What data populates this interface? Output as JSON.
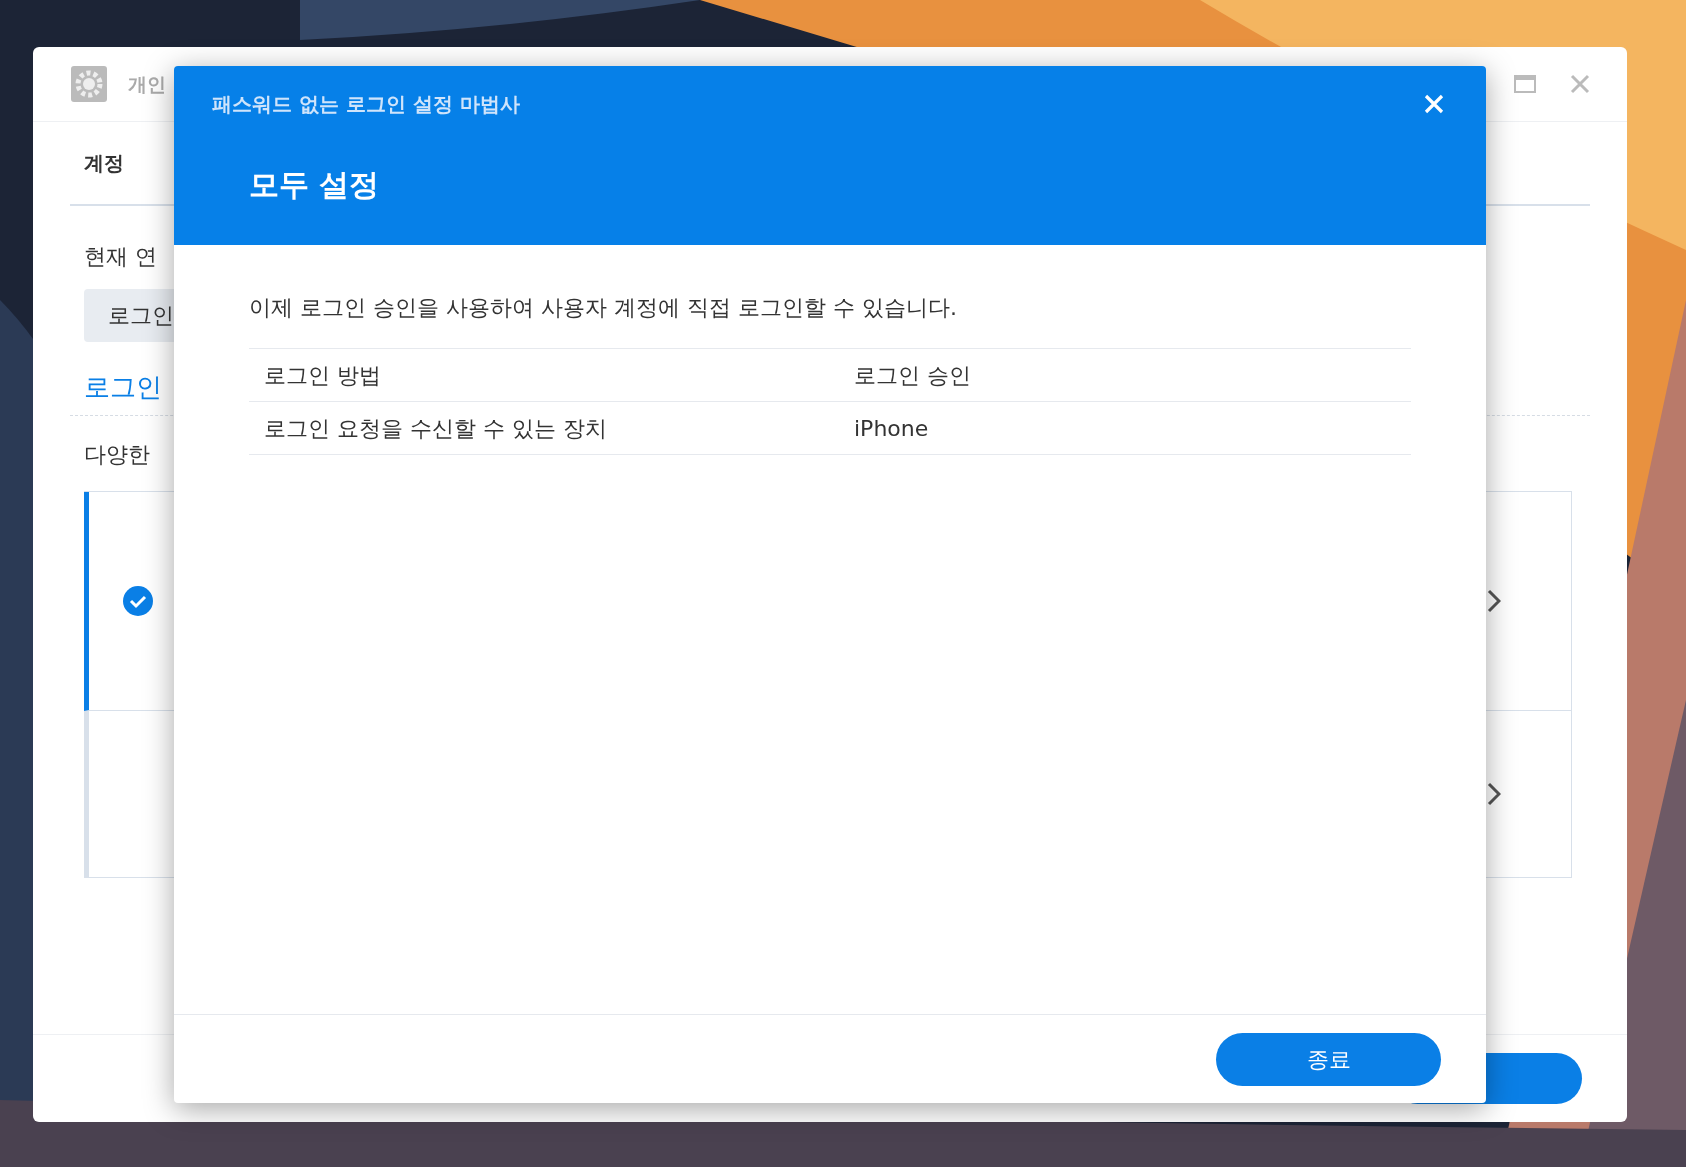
{
  "background_window": {
    "title": "개인",
    "tabs": [
      {
        "label": "계정",
        "selected": true
      }
    ],
    "section_label": "현재 연",
    "session_chip": "로그인",
    "link": "로그인",
    "description": "다양한",
    "methods": [
      {
        "selected": true
      },
      {
        "selected": false
      }
    ]
  },
  "dialog": {
    "title": "패스워드 없는 로그인 설정 마법사",
    "heading": "모두 설정",
    "message": "이제 로그인 승인을 사용하여 사용자 계정에 직접 로그인할 수 있습니다.",
    "summary": [
      {
        "label": "로그인 방법",
        "value": "로그인 승인"
      },
      {
        "label": "로그인 요청을 수신할 수 있는 장치",
        "value": "iPhone"
      }
    ],
    "buttons": [
      "종료"
    ]
  }
}
